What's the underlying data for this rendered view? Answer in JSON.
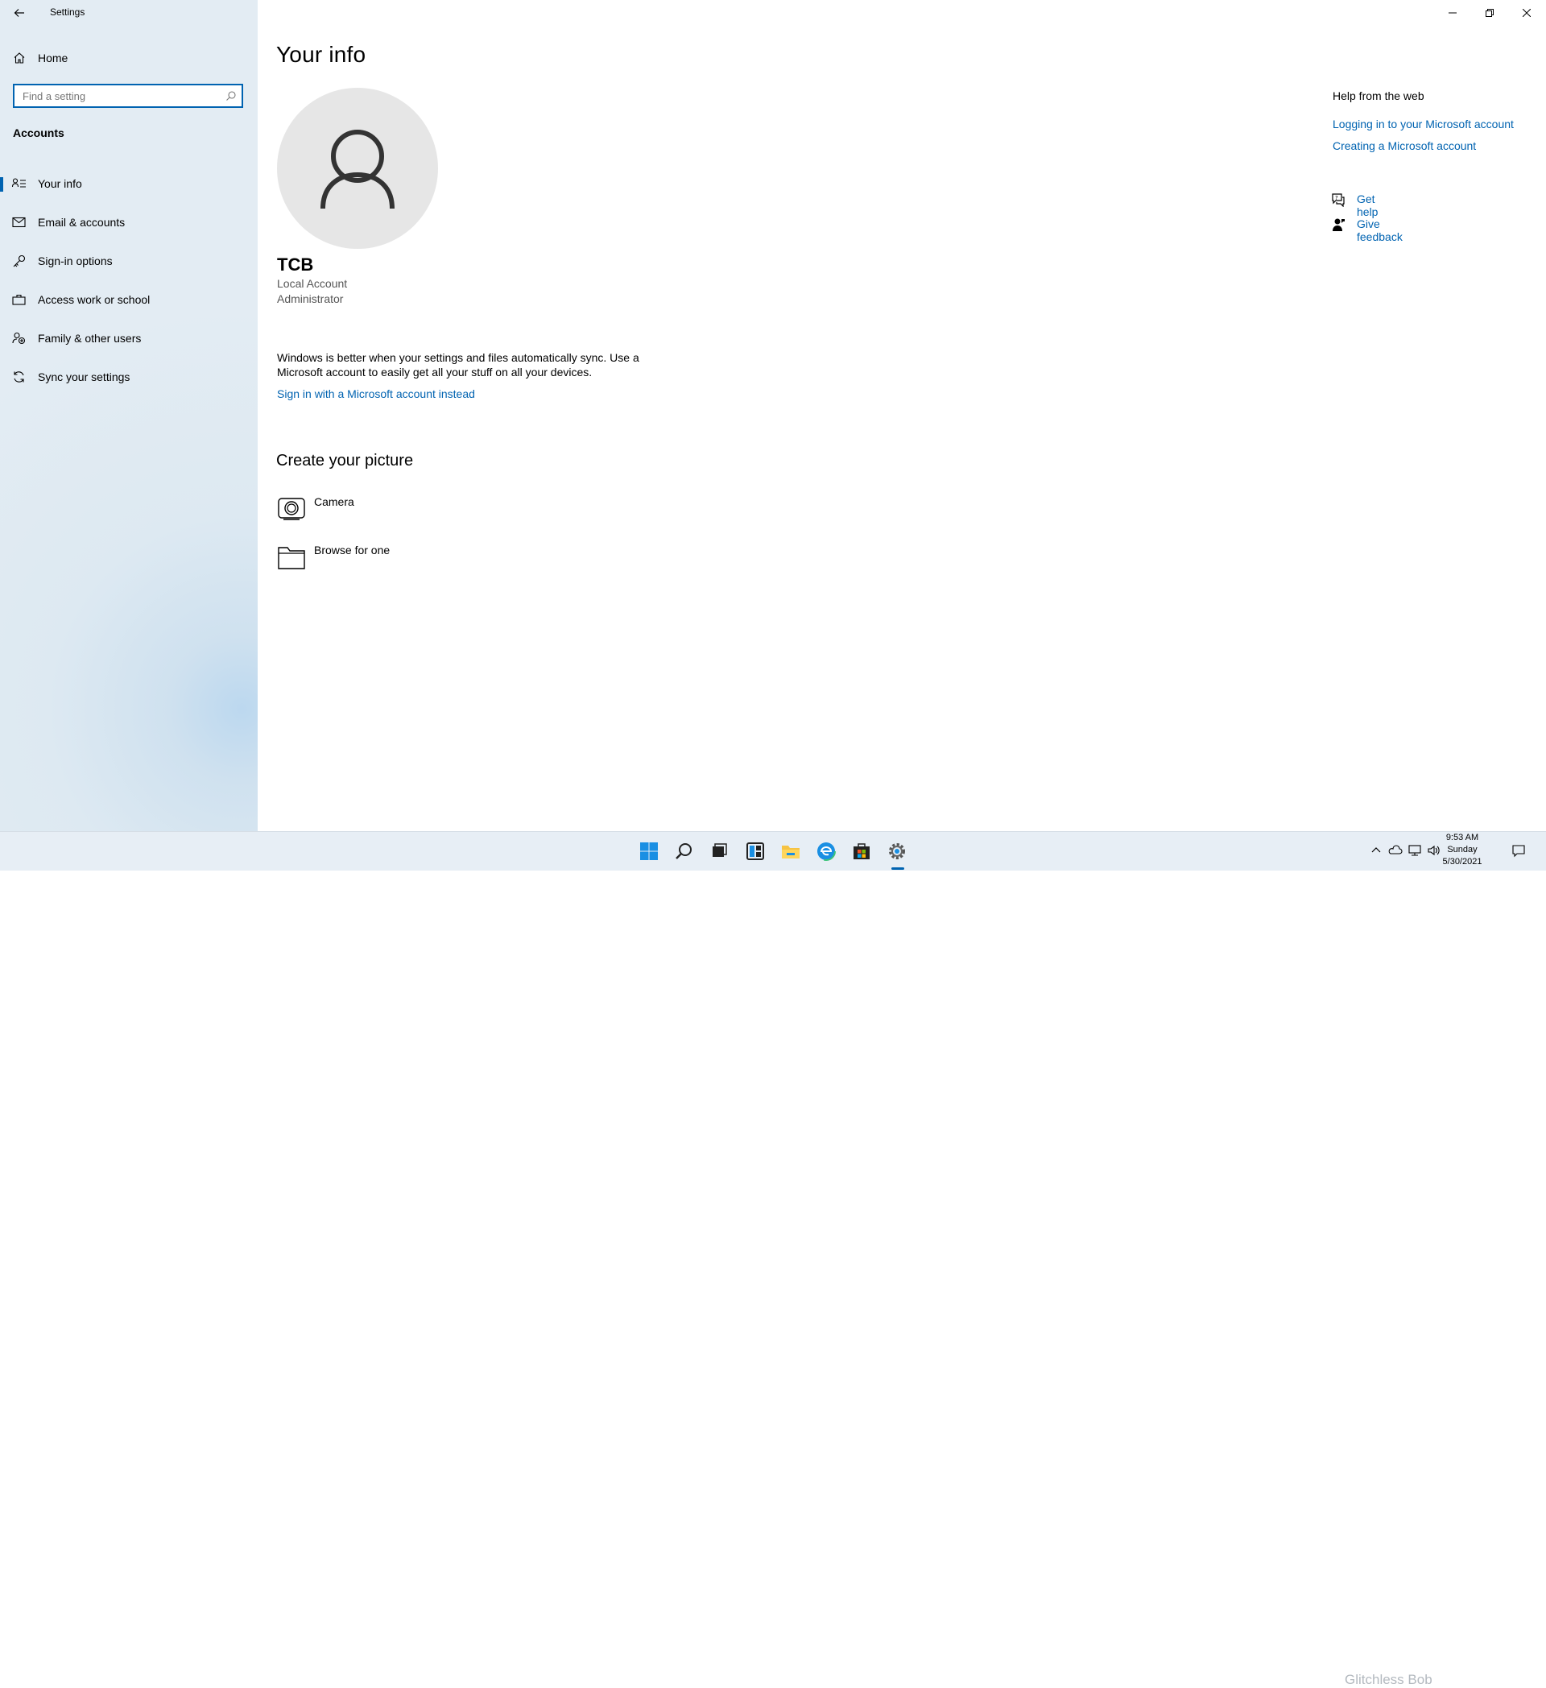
{
  "window": {
    "title": "Settings",
    "controls": [
      "minimize-icon",
      "restore-icon",
      "close-icon"
    ]
  },
  "sidebar": {
    "home_label": "Home",
    "search_placeholder": "Find a setting",
    "section_title": "Accounts",
    "items": [
      {
        "label": "Your info",
        "icon": "contact-info-icon",
        "selected": true
      },
      {
        "label": "Email & accounts",
        "icon": "mail-icon",
        "selected": false
      },
      {
        "label": "Sign-in options",
        "icon": "key-icon",
        "selected": false
      },
      {
        "label": "Access work or school",
        "icon": "briefcase-icon",
        "selected": false
      },
      {
        "label": "Family & other users",
        "icon": "add-user-icon",
        "selected": false
      },
      {
        "label": "Sync your settings",
        "icon": "sync-icon",
        "selected": false
      }
    ]
  },
  "main": {
    "title": "Your info",
    "user": {
      "name": "TCB",
      "account_type": "Local Account",
      "role": "Administrator"
    },
    "sync_message": "Windows is better when your settings and files automatically sync. Use a Microsoft account to easily get all your stuff on all your devices.",
    "ms_account_link": "Sign in with a Microsoft account instead",
    "create_picture": {
      "title": "Create your picture",
      "options": [
        {
          "label": "Camera",
          "icon": "camera-icon"
        },
        {
          "label": "Browse for one",
          "icon": "folder-icon"
        }
      ]
    }
  },
  "help": {
    "title": "Help from the web",
    "links": [
      "Logging in to your Microsoft account",
      "Creating a Microsoft account"
    ],
    "get_help": "Get help",
    "give_feedback": "Give feedback"
  },
  "taskbar": {
    "apps": [
      "start-icon",
      "search-icon",
      "task-view-icon",
      "widgets-icon",
      "file-explorer-icon",
      "edge-icon",
      "store-icon",
      "settings-icon"
    ],
    "active_app": "settings-icon",
    "clock": {
      "time": "9:53 AM",
      "day": "Sunday",
      "date": "5/30/2021"
    },
    "watermark": "Glitchless Bob"
  },
  "colors": {
    "accent": "#0063b1",
    "sidebar_bg": "#e3ecf3",
    "avatar_bg": "#e6e6e6"
  }
}
